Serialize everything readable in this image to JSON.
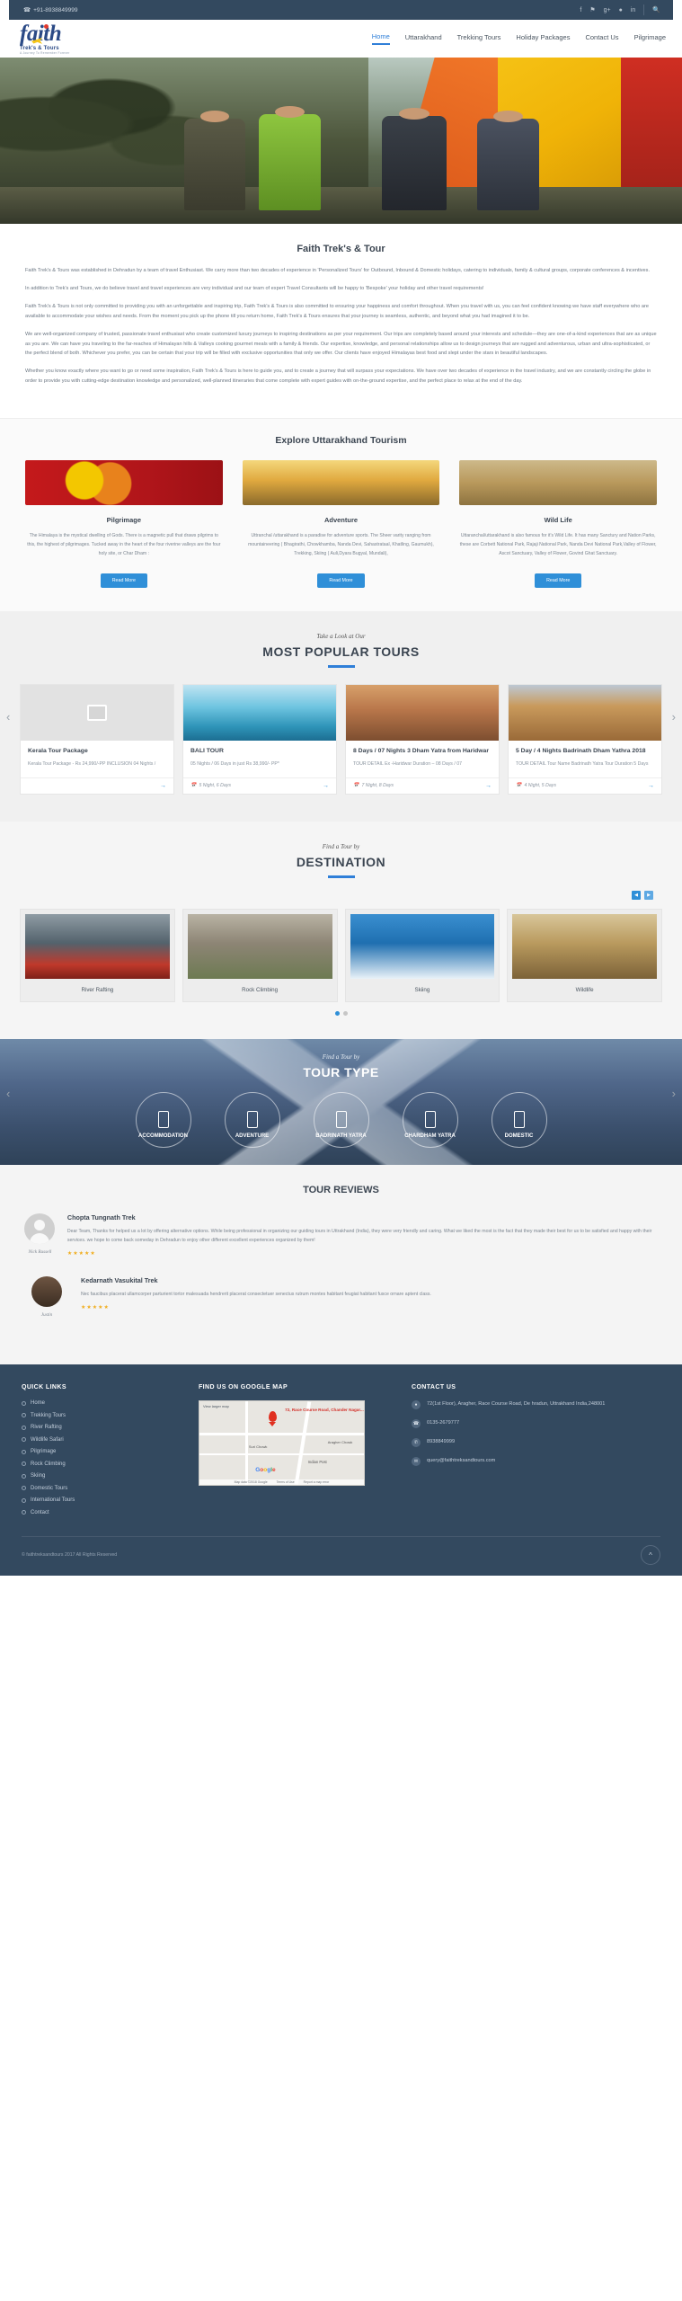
{
  "topbar": {
    "phone": "+91-8938849999",
    "phone_icon": "phone-icon",
    "socials": [
      "facebook-icon",
      "twitter-icon",
      "google-plus-icon",
      "pinterest-icon",
      "linkedin-icon"
    ],
    "search_icon": "search-icon"
  },
  "header": {
    "logo_text": "faith",
    "logo_tagline": "Trek's & Tours",
    "logo_subtagline": "A Journey To Remember Forever",
    "nav": [
      {
        "label": "Home",
        "active": true
      },
      {
        "label": "Uttarakhand",
        "active": false
      },
      {
        "label": "Trekking Tours",
        "active": false
      },
      {
        "label": "Holiday Packages",
        "active": false
      },
      {
        "label": "Contact Us",
        "active": false
      },
      {
        "label": "Pilgrimage",
        "active": false
      }
    ]
  },
  "about": {
    "title": "Faith Trek's & Tour",
    "paragraphs": [
      "Faith Trek's & Tours was established in Dehradun by a team of travel Enthusiast. We carry more than two decades of experience in 'Personalized Tours' for Outbound, Inbound & Domestic holidays, catering to individuals, family & cultural groups, corporate conferences & incentives.",
      "In addition to Trek's and Tours, we do believe travel and travel experiences are very individual and our team of expert Travel Consultants will be happy to 'Bespoke' your holiday and other travel requirements!",
      "Faith Trek's & Tours is not only committed to providing you with an unforgettable and inspiring trip, Faith Trek's & Tours is also committed to ensuring your happiness and comfort throughout. When you travel with us, you can feel confident knowing we have staff everywhere who are available to accommodate your wishes and needs. From the moment you pick up the phone till you return home, Faith Trek's & Tours ensures that your journey is seamless, authentic, and beyond what you had imagined it to be.",
      "We are well-organized company of trusted, passionate travel enthusiast who create customized luxury journeys to inspiring destinations as per your requirement. Our trips are completely based around your interests and schedule—they are one-of-a-kind experiences that are as unique as you are. We can have you traveling to the far-reaches of Himalayan hills & Valleys cooking gourmet meals with a family & friends. Our expertise, knowledge, and personal relationships allow us to design journeys that are rugged and adventurous, urban and ultra-sophisticated, or the perfect blend of both. Whichever you prefer, you can be certain that your trip will be filled with exclusive opportunities that only we offer. Our clients have enjoyed Himalayas best food and slept under the stars in beautiful landscapes.",
      "Whether you know exactly where you want to go or need some inspiration, Faith Trek's & Tours is here to guide you, and to create a journey that will surpass your expectations. We have over two decades of experience in the travel industry, and we are constantly circling the globe in order to provide you with cutting-edge destination knowledge and personalized, well-planned itineraries that come complete with expert guides with on-the-ground expertise, and the perfect place to relax at the end of the day."
    ]
  },
  "explore": {
    "title": "Explore Uttarakhand Tourism",
    "cards": [
      {
        "image": "pilgrimage-photo",
        "title": "Pilgrimage",
        "text": "The Himalaya is the mystical dwelling of Gods. There is a magnetic pull that draws pilgrims to this, the highest of pilgrimages. Tucked away in the heart of the four riverine valleys are the four holy site, or Char Dham :",
        "button": "Read More"
      },
      {
        "image": "adventure-photo",
        "title": "Adventure",
        "text": "Uttranchal /uttarakhand is a paradise for adventure sports. The Sheer varity ranging from mountaineering ( Bhagirathi, Chowkhamba, Nanda Devi, Sahastrataal, Khatling, Gaumukh), Trekking, Skiing ( Auli,Dyara Bugyal, Mundali),",
        "button": "Read More"
      },
      {
        "image": "wildlife-photo",
        "title": "Wild Life",
        "text": "Uttaranchal/uttarakhand is also famous for it's Wild Life. It has many Sanctury and Nation Parks, these are Corbett National Park, Rajaji National Park, Nanda Devi National Park,Valley of Flower, Ascot Sanctuary, Valley of Flower, Govind Ghat Sanctuary.",
        "button": "Read More"
      }
    ]
  },
  "popular": {
    "eyebrow": "Take a Look at Our",
    "title": "MOST POPULAR TOURS",
    "prev_icon": "chevron-left-icon",
    "next_icon": "chevron-right-icon",
    "tours": [
      {
        "image": "image-placeholder",
        "title": "Kerala Tour Package",
        "desc": "Kerala Tour Package - Rs 24,990/-PP INCLUSION 04 Nights /",
        "duration": "",
        "arrow": "arrow-right-icon"
      },
      {
        "image": "bali-photo",
        "title": "BALI TOUR",
        "desc": "05 Nights / 06 Days in just Rs 38,990/- PP*",
        "duration": "5 Night, 6 Days",
        "arrow": "arrow-right-icon"
      },
      {
        "image": "dham-yatra-photo",
        "title": "8 Days / 07 Nights 3 Dham Yatra from Haridwar",
        "desc": "TOUR DETAIL Ex -Haridwar Duration – 08 Days / 07",
        "duration": "7 Night, 8 Days",
        "arrow": "arrow-right-icon"
      },
      {
        "image": "badrinath-photo",
        "title": "5 Day / 4 Nights Badrinath Dham Yathra 2018",
        "desc": "TOUR DETAIL Tour Name Badrinath Yatra Tour Duration 5 Days",
        "duration": "4 Night, 5 Days",
        "arrow": "arrow-right-icon"
      }
    ]
  },
  "destination": {
    "eyebrow": "Find a Tour by",
    "title": "DESTINATION",
    "pager": [
      "◀",
      "▶"
    ],
    "items": [
      {
        "image": "river-rafting-photo",
        "label": "River Rafting"
      },
      {
        "image": "rock-climbing-photo",
        "label": "Rock Climbing"
      },
      {
        "image": "skiing-photo",
        "label": "Skiing"
      },
      {
        "image": "wildlife-photo",
        "label": "Wildlife"
      }
    ]
  },
  "tourtype": {
    "eyebrow": "Find a Tour by",
    "title": "TOUR TYPE",
    "prev_icon": "chevron-left-icon",
    "next_icon": "chevron-right-icon",
    "items": [
      {
        "icon": "tour-type-icon",
        "label": "ACCOMMODATION"
      },
      {
        "icon": "tour-type-icon",
        "label": "ADVENTURE"
      },
      {
        "icon": "tour-type-icon",
        "label": "BADRINATH YATRA"
      },
      {
        "icon": "tour-type-icon",
        "label": "CHARDHAM YATRA"
      },
      {
        "icon": "tour-type-icon",
        "label": "DOMESTIC"
      }
    ]
  },
  "reviews": {
    "title": "TOUR REVIEWS",
    "items": [
      {
        "avatar": "default-avatar",
        "signature": "Nick Russell",
        "name": "Chopta Tungnath Trek",
        "text": "Dear Team, Thanks for helped us a lot by offering alternative options. While being professional in organizing our guiding tours in Uttrakhand (India), they were very friendly and caring. What we liked the most is the fact that they made their best for us to be satisfied and happy with their services. we hope to come back someday in Dehradun to enjoy other different excellent experiences organized by them!",
        "rating": 5
      },
      {
        "avatar": "user-photo",
        "signature": "Justin",
        "name": "Kedarnath Vasukital Trek",
        "text": "Nec faucibus placerat ullamcorper parturient tortor malesuada hendrerit placerat consectetuer senectus rutrum montes habitant feugiat habitant fusce ornare aptent class.",
        "rating": 5
      }
    ]
  },
  "footer": {
    "quick_links_title": "QUICK LINKS",
    "quick_links": [
      "Home",
      "Trekking Tours",
      "River Rafting",
      "Wildlife Safari",
      "Pilgrimage",
      "Rock Climbing",
      "Skiing",
      "Domestic Tours",
      "International Tours",
      "Contact"
    ],
    "map_title": "FIND US ON GOOGLE MAP",
    "map": {
      "header": "View larger map",
      "pin_label": "72, Race Course Road, Chander Nagar...",
      "place1": "Suri Chowk",
      "place2": "Aragher Chowk",
      "place3": "Indian Post",
      "brand": "Google",
      "credits": [
        "Map data ©2018 Google",
        "Terms of Use",
        "Report a map error"
      ]
    },
    "contact_title": "CONTACT US",
    "contacts": [
      {
        "icon": "location-icon",
        "text": "72(1st Floor), Aragher, Race Course Road, De hradun, Uttrakhand India,248001"
      },
      {
        "icon": "phone-icon",
        "text": "0135-2679777"
      },
      {
        "icon": "mobile-icon",
        "text": "8938849999"
      },
      {
        "icon": "email-icon",
        "text": "query@faithtreksandtours.com"
      }
    ],
    "copyright": "© faithtreksandtours 2017 All Rights Reserved",
    "to_top_icon": "chevron-up-icon"
  },
  "colors": {
    "accent": "#2f8fd8",
    "dark": "#33495f",
    "star": "#f0ad1e"
  }
}
